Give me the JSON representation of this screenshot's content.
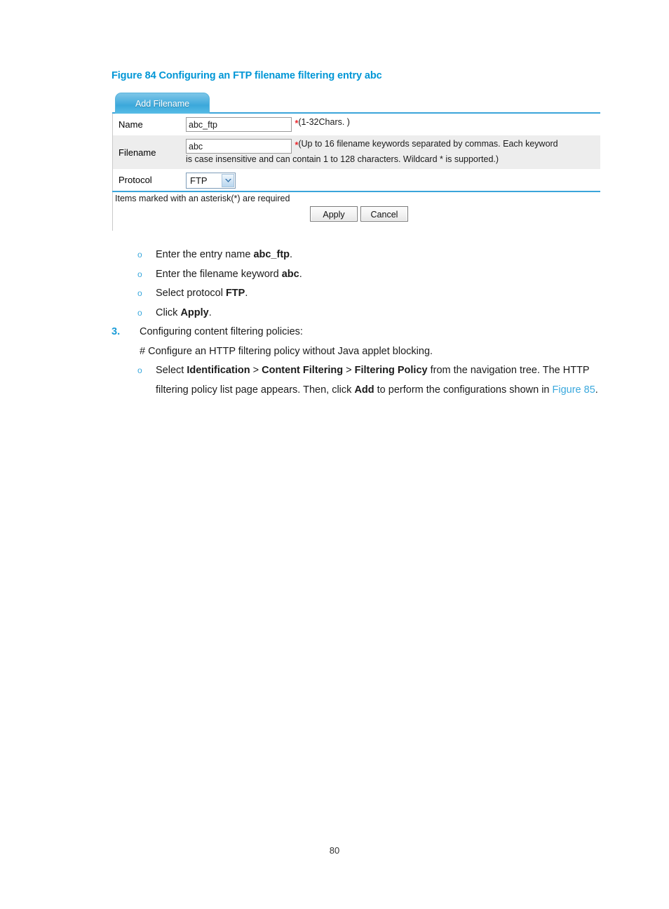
{
  "figure": {
    "caption": "Figure 84 Configuring an FTP filename filtering entry abc",
    "tab_label": "Add Filename",
    "rows": {
      "name": {
        "label": "Name",
        "value": "abc_ftp",
        "star": "*",
        "hint": "(1-32Chars. )"
      },
      "filename": {
        "label": "Filename",
        "value": "abc",
        "star": "*",
        "hint_line1": "(Up to 16 filename keywords separated by commas. Each keyword",
        "hint_line2": "is case insensitive and can contain 1 to 128 characters. Wildcard * is supported.)"
      },
      "protocol": {
        "label": "Protocol",
        "selected": "FTP",
        "options": [
          "FTP"
        ]
      }
    },
    "required_note": "Items marked with an asterisk(*) are required",
    "apply_label": "Apply",
    "cancel_label": "Cancel"
  },
  "steps": {
    "bullets": [
      {
        "pre": "Enter the entry name ",
        "bold": "abc_ftp",
        "post": "."
      },
      {
        "pre": "Enter the filename keyword ",
        "bold": "abc",
        "post": "."
      },
      {
        "pre": "Select protocol ",
        "bold": "FTP",
        "post": "."
      },
      {
        "pre": "Click ",
        "bold": "Apply",
        "post": "."
      }
    ],
    "step3": {
      "number": "3.",
      "text": "Configuring content filtering policies:",
      "hash_line": "# Configure an HTTP filtering policy without Java applet blocking.",
      "bullet": {
        "s1": "Select ",
        "b1": "Identification",
        "s2": " > ",
        "b2": "Content Filtering",
        "s3": " > ",
        "b3": "Filtering Policy",
        "s4": " from the navigation tree. The HTTP filtering policy list page appears. Then, click ",
        "b4": "Add",
        "s5": " to perform the configurations shown in ",
        "link": "Figure 85",
        "s6": "."
      }
    }
  },
  "page_number": "80",
  "colors": {
    "accent_blue": "#0096d6",
    "link_blue": "#3aa8dd",
    "tab_blue": "#3ba5da",
    "required_red": "#e8262c",
    "alt_row": "#ededed"
  }
}
